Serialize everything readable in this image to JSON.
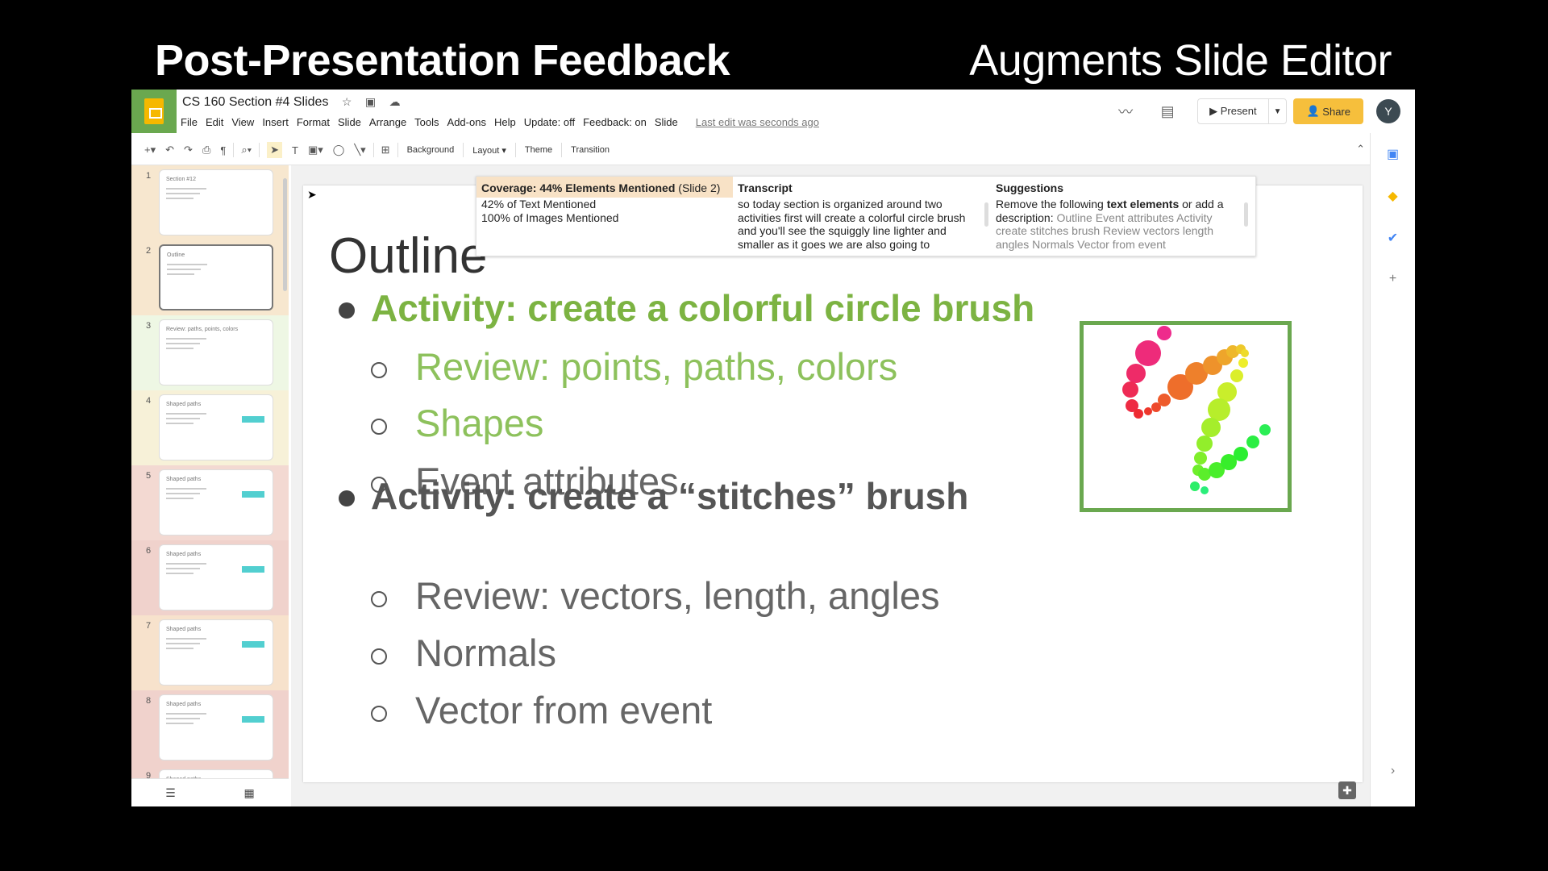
{
  "captions": {
    "left": "Post-Presentation Feedback",
    "right": "Augments Slide Editor"
  },
  "doc": {
    "title": "CS 160 Section #4 Slides"
  },
  "menu": [
    "File",
    "Edit",
    "View",
    "Insert",
    "Format",
    "Slide",
    "Arrange",
    "Tools",
    "Add-ons",
    "Help",
    "Update: off",
    "Feedback: on",
    "Slide"
  ],
  "last_edit": "Last edit was seconds ago",
  "header": {
    "present": "Present",
    "share": "Share",
    "avatar": "Y"
  },
  "toolbar": {
    "background": "Background",
    "layout": "Layout",
    "theme": "Theme",
    "transition": "Transition"
  },
  "filmstrip": [
    {
      "num": "1",
      "title": "Section #12",
      "bg": "#f7e7cf"
    },
    {
      "num": "2",
      "title": "Outline",
      "bg": "#f7e7cf",
      "active": true
    },
    {
      "num": "3",
      "title": "Review: paths, points, colors",
      "bg": "#eef7e4"
    },
    {
      "num": "4",
      "title": "Shaped paths",
      "bg": "#f7f1d8"
    },
    {
      "num": "5",
      "title": "Shaped paths",
      "bg": "#f3d9d2"
    },
    {
      "num": "6",
      "title": "Shaped paths",
      "bg": "#f0d2cc"
    },
    {
      "num": "7",
      "title": "Shaped paths",
      "bg": "#f7e2cc"
    },
    {
      "num": "8",
      "title": "Shaped paths",
      "bg": "#f0d2cc"
    },
    {
      "num": "9",
      "title": "Shaped paths",
      "bg": "#f0d2cc"
    }
  ],
  "slide": {
    "title": "Outline",
    "bullet1": "Activity: create a colorful circle brush",
    "sub1": [
      "Review: points, paths, colors",
      "Shapes",
      "Event attributes"
    ],
    "bullet2": "Activity: create a “stitches” brush",
    "sub2": [
      "Review: vectors, length, angles",
      "Normals",
      "Vector from event"
    ]
  },
  "feedback": {
    "coverage_title": "Coverage: 44% Elements Mentioned",
    "coverage_slide": "(Slide 2)",
    "text_mentioned": "42% of Text Mentioned",
    "images_mentioned": "100% of Images Mentioned",
    "transcript_title": "Transcript",
    "transcript": "so today section is organized around two activities first will create a colorful circle brush and you'll see the squiggly line lighter and smaller as it goes we are also going to",
    "suggestions_title": "Suggestions",
    "suggestion_pre": "Remove the following ",
    "suggestion_bold": "text elements",
    "suggestion_post": " or add a description: ",
    "suggestion_items": "Outline Event attributes Activity create stitches brush Review vectors length angles Normals Vector from event"
  },
  "colors": {
    "accent_green": "#7cb342",
    "share": "#f6bf3c",
    "coverage_highlight": "#f8e2c6"
  }
}
